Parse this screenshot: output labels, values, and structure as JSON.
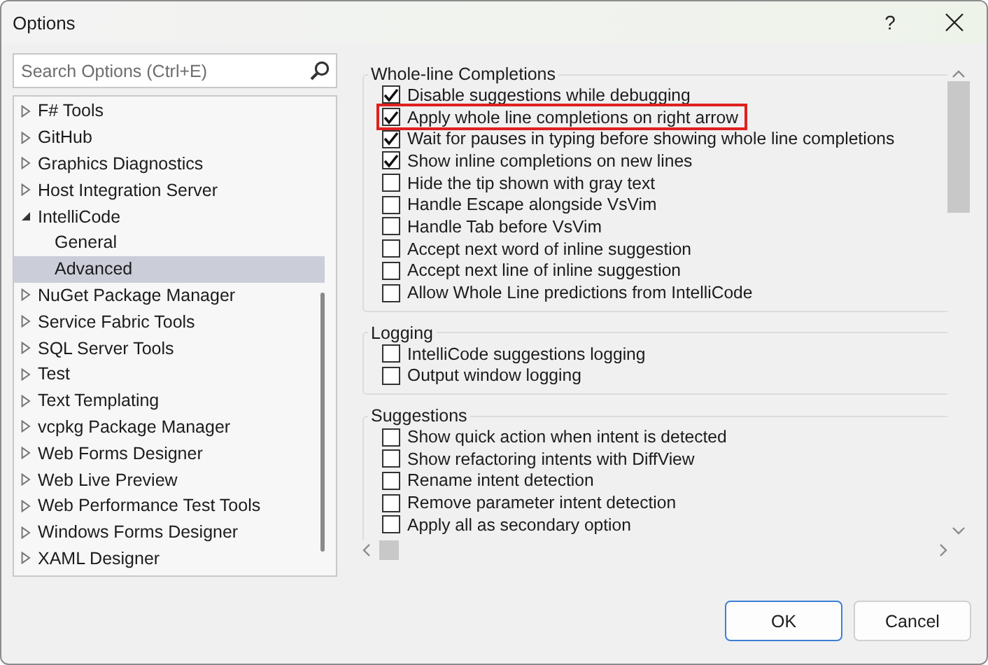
{
  "window": {
    "title": "Options",
    "help": "?"
  },
  "search": {
    "placeholder": "Search Options (Ctrl+E)"
  },
  "tree": [
    {
      "label": "F# Tools",
      "expanded": false,
      "selected": false
    },
    {
      "label": "GitHub",
      "expanded": false,
      "selected": false
    },
    {
      "label": "Graphics Diagnostics",
      "expanded": false,
      "selected": false
    },
    {
      "label": "Host Integration Server",
      "expanded": false,
      "selected": false
    },
    {
      "label": "IntelliCode",
      "expanded": true,
      "selected": false,
      "children": [
        {
          "label": "General",
          "selected": false
        },
        {
          "label": "Advanced",
          "selected": true
        }
      ]
    },
    {
      "label": "NuGet Package Manager",
      "expanded": false,
      "selected": false
    },
    {
      "label": "Service Fabric Tools",
      "expanded": false,
      "selected": false
    },
    {
      "label": "SQL Server Tools",
      "expanded": false,
      "selected": false
    },
    {
      "label": "Test",
      "expanded": false,
      "selected": false
    },
    {
      "label": "Text Templating",
      "expanded": false,
      "selected": false
    },
    {
      "label": "vcpkg Package Manager",
      "expanded": false,
      "selected": false
    },
    {
      "label": "Web Forms Designer",
      "expanded": false,
      "selected": false
    },
    {
      "label": "Web Live Preview",
      "expanded": false,
      "selected": false
    },
    {
      "label": "Web Performance Test Tools",
      "expanded": false,
      "selected": false
    },
    {
      "label": "Windows Forms Designer",
      "expanded": false,
      "selected": false
    },
    {
      "label": "XAML Designer",
      "expanded": false,
      "selected": false
    }
  ],
  "groups": [
    {
      "title": "Whole-line Completions",
      "options": [
        {
          "label": "Disable suggestions while debugging",
          "checked": true,
          "highlighted": false
        },
        {
          "label": "Apply whole line completions on right arrow",
          "checked": true,
          "highlighted": true
        },
        {
          "label": "Wait for pauses in typing before showing whole line completions",
          "checked": true,
          "highlighted": false
        },
        {
          "label": "Show inline completions on new lines",
          "checked": true,
          "highlighted": false
        },
        {
          "label": "Hide the tip shown with gray text",
          "checked": false,
          "highlighted": false
        },
        {
          "label": "Handle Escape alongside VsVim",
          "checked": false,
          "highlighted": false
        },
        {
          "label": "Handle Tab before VsVim",
          "checked": false,
          "highlighted": false
        },
        {
          "label": "Accept next word of inline suggestion",
          "checked": false,
          "highlighted": false
        },
        {
          "label": "Accept next line of inline suggestion",
          "checked": false,
          "highlighted": false
        },
        {
          "label": "Allow Whole Line predictions from IntelliCode",
          "checked": false,
          "highlighted": false
        }
      ]
    },
    {
      "title": "Logging",
      "options": [
        {
          "label": "IntelliCode suggestions logging",
          "checked": false,
          "highlighted": false
        },
        {
          "label": "Output window logging",
          "checked": false,
          "highlighted": false
        }
      ]
    },
    {
      "title": "Suggestions",
      "options": [
        {
          "label": "Show quick action when intent is detected",
          "checked": false,
          "highlighted": false
        },
        {
          "label": "Show refactoring intents with DiffView",
          "checked": false,
          "highlighted": false
        },
        {
          "label": "Rename intent detection",
          "checked": false,
          "highlighted": false
        },
        {
          "label": "Remove parameter intent detection",
          "checked": false,
          "highlighted": false
        },
        {
          "label": "Apply all as secondary option",
          "checked": false,
          "highlighted": false
        }
      ]
    }
  ],
  "buttons": [
    {
      "label": "OK",
      "default": true
    },
    {
      "label": "Cancel",
      "default": false
    }
  ]
}
